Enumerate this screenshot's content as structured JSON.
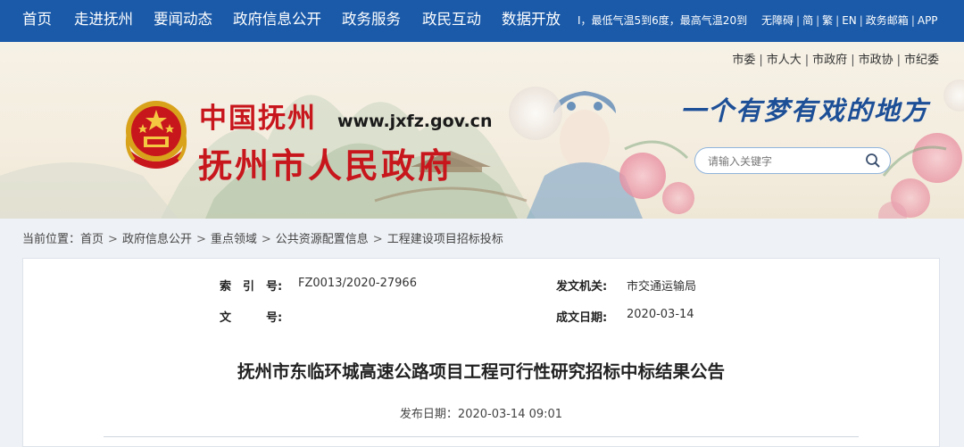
{
  "nav": {
    "items": [
      {
        "label": "首页"
      },
      {
        "label": "走进抚州"
      },
      {
        "label": "要闻动态"
      },
      {
        "label": "政府信息公开"
      },
      {
        "label": "政务服务"
      },
      {
        "label": "政民互动"
      },
      {
        "label": "数据开放"
      }
    ],
    "weather": "Ⅰ，最低气温5到6度，最高气温20到",
    "tools": [
      "无障碍",
      "简",
      "繁",
      "EN",
      "政务邮箱",
      "APP"
    ]
  },
  "banner": {
    "top_links": [
      "市委",
      "市人大",
      "市政府",
      "市政协",
      "市纪委"
    ],
    "brand_small": "中国抚州",
    "domain": "www.jxfz.gov.cn",
    "brand_big": "抚州市人民政府",
    "slogan": "一个有梦有戏的地方",
    "search_placeholder": "请输入关键字",
    "colors": {
      "brand_red": "#c8161d",
      "nav_blue": "#1a5aa9",
      "slogan_blue": "#1d4f97"
    }
  },
  "breadcrumb": {
    "prefix": "当前位置：",
    "items": [
      "首页",
      "政府信息公开",
      "重点领域",
      "公共资源配置信息",
      "工程建设项目招标投标"
    ],
    "separator": ">"
  },
  "article": {
    "meta": {
      "index_label": "索　引　号:",
      "index_value": "FZ0013/2020-27966",
      "issuer_label": "发文机关:",
      "issuer_value": "市交通运输局",
      "docno_label": "文　　　号:",
      "docno_value": "",
      "date_label": "成文日期:",
      "date_value": "2020-03-14"
    },
    "title": "抚州市东临环城高速公路项目工程可行性研究招标中标结果公告",
    "publish_label": "发布日期：",
    "publish_value": "2020-03-14 09:01"
  }
}
